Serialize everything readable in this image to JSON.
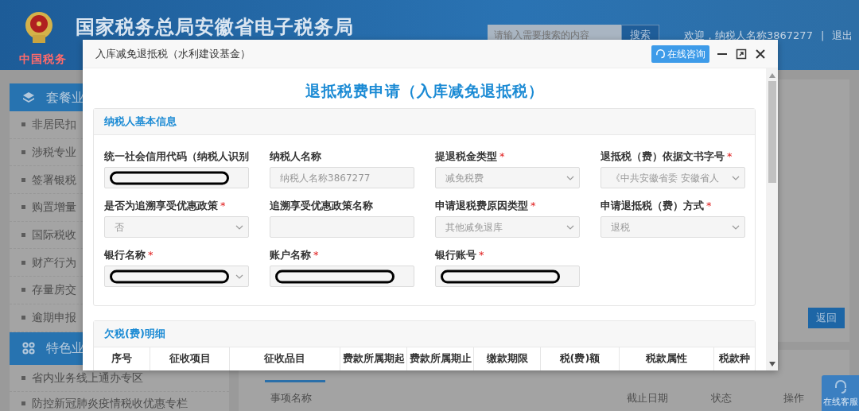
{
  "header": {
    "logo_text": "中国税务",
    "title": "国家税务总局安徽省电子税务局",
    "search_placeholder": "请输入需要搜索的内容",
    "search_button": "搜索",
    "welcome": "欢迎，纳税人名称3867277",
    "separator": "|",
    "logout": "退出"
  },
  "sidebar": {
    "groups": [
      {
        "title": "套餐业",
        "items": [
          "非居民扣",
          "涉税专业",
          "签署银税",
          "购置增量",
          "国际税收",
          "财产行为",
          "存量房交",
          "逾期申报"
        ]
      },
      {
        "title": "特色业",
        "items": [
          "省内业务线上通办专区",
          "防控新冠肺炎疫情税收优惠专栏"
        ]
      }
    ]
  },
  "content": {
    "back_button": "返回",
    "table_columns": [
      "事项名称",
      "截止日期",
      "状态",
      "操作"
    ]
  },
  "float_button": {
    "label": "在线客服"
  },
  "dialog": {
    "title": "入库减免退抵税（水利建设基金）",
    "consult_button": "在线咨询",
    "heading": "退抵税费申请（入库减免退抵税）",
    "basic_section": {
      "title": "纳税人基本信息",
      "fields": [
        {
          "label": "统一社会信用代码（纳税人识别",
          "kind": "input",
          "redacted": true
        },
        {
          "label": "纳税人名称",
          "kind": "input",
          "value": "纳税人名称3867277"
        },
        {
          "label": "提退税金类型",
          "required_mark": "*",
          "kind": "select",
          "value": "减免税费"
        },
        {
          "label": "退抵税（费）依据文书字号",
          "required_mark": "*",
          "kind": "select",
          "value": "《中共安徽省委 安徽省人"
        },
        {
          "label": "是否为追溯享受优惠政策",
          "required_mark": "*",
          "kind": "select",
          "value": "否"
        },
        {
          "label": "追溯享受优惠政策名称",
          "kind": "input"
        },
        {
          "label": "申请退税费原因类型",
          "required_mark": "*",
          "kind": "select",
          "value": "其他减免退库"
        },
        {
          "label": "申请退抵税（费）方式",
          "required_mark": "*",
          "kind": "select",
          "value": "退税"
        },
        {
          "label": "银行名称",
          "required_mark": "*",
          "kind": "select",
          "redacted": true
        },
        {
          "label": "账户名称",
          "required_mark": "*",
          "kind": "input",
          "redacted": true
        },
        {
          "label": "银行账号",
          "required_mark": "*",
          "kind": "input",
          "redacted": true
        }
      ]
    },
    "arrears_section": {
      "title": "欠税(费)明细",
      "columns": [
        "序号",
        "征收项目",
        "征收品目",
        "费款所属期起",
        "费款所属期止",
        "缴款期限",
        "税(费)额",
        "税款属性",
        "税款种"
      ]
    }
  }
}
